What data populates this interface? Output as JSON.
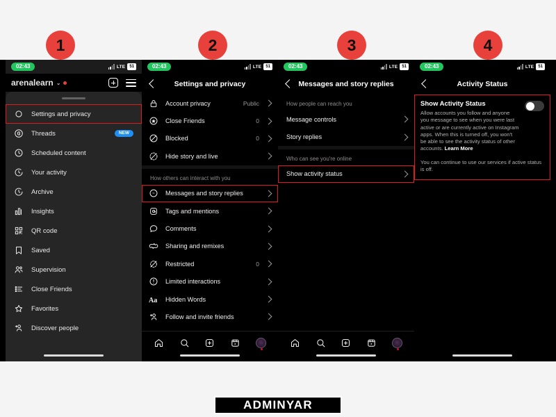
{
  "watermark": "ADMINYAR",
  "colors": {
    "accent_red": "#e8403a",
    "highlight_red": "#e01b1b",
    "badge_blue": "#1f8ff5",
    "clock_green": "#22c55e"
  },
  "statusbar": {
    "time": "02:43",
    "network": "LTE",
    "battery": "51"
  },
  "steps": [
    {
      "number": "1"
    },
    {
      "number": "2"
    },
    {
      "number": "3"
    },
    {
      "number": "4"
    }
  ],
  "panel1": {
    "username": "arenalearn",
    "caret": "⌄",
    "menu": [
      {
        "label": "Settings and privacy",
        "icon": "gear-icon",
        "badge": "",
        "highlight": true
      },
      {
        "label": "Threads",
        "icon": "threads-icon",
        "badge": "NEW",
        "highlight": false
      },
      {
        "label": "Scheduled content",
        "icon": "clock-icon",
        "badge": "",
        "highlight": false
      },
      {
        "label": "Your activity",
        "icon": "activity-clock-icon",
        "badge": "",
        "highlight": false
      },
      {
        "label": "Archive",
        "icon": "archive-clock-icon",
        "badge": "",
        "highlight": false
      },
      {
        "label": "Insights",
        "icon": "insights-chart-icon",
        "badge": "",
        "highlight": false
      },
      {
        "label": "QR code",
        "icon": "qr-code-icon",
        "badge": "",
        "highlight": false
      },
      {
        "label": "Saved",
        "icon": "bookmark-icon",
        "badge": "",
        "highlight": false
      },
      {
        "label": "Supervision",
        "icon": "supervision-people-icon",
        "badge": "",
        "highlight": false
      },
      {
        "label": "Close Friends",
        "icon": "close-friends-list-icon",
        "badge": "",
        "highlight": false
      },
      {
        "label": "Favorites",
        "icon": "star-icon",
        "badge": "",
        "highlight": false
      },
      {
        "label": "Discover people",
        "icon": "discover-people-icon",
        "badge": "",
        "highlight": false
      }
    ]
  },
  "panel2": {
    "title": "Settings and privacy",
    "group1": [
      {
        "label": "Account privacy",
        "value": "Public",
        "icon": "lock-icon",
        "highlight": false
      },
      {
        "label": "Close Friends",
        "value": "0",
        "icon": "star-circle-icon",
        "highlight": false
      },
      {
        "label": "Blocked",
        "value": "0",
        "icon": "blocked-icon",
        "highlight": false
      },
      {
        "label": "Hide story and live",
        "value": "",
        "icon": "hide-story-icon",
        "highlight": false
      }
    ],
    "section_header": "How others can interact with you",
    "group2": [
      {
        "label": "Messages and story replies",
        "value": "",
        "icon": "messenger-icon",
        "highlight": true
      },
      {
        "label": "Tags and mentions",
        "value": "",
        "icon": "at-icon",
        "highlight": false
      },
      {
        "label": "Comments",
        "value": "",
        "icon": "comment-icon",
        "highlight": false
      },
      {
        "label": "Sharing and remixes",
        "value": "",
        "icon": "remix-icon",
        "highlight": false
      },
      {
        "label": "Restricted",
        "value": "0",
        "icon": "restricted-icon",
        "highlight": false
      },
      {
        "label": "Limited interactions",
        "value": "",
        "icon": "limited-icon",
        "highlight": false
      },
      {
        "label": "Hidden Words",
        "value": "",
        "icon": "hidden-words-icon",
        "highlight": false
      },
      {
        "label": "Follow and invite friends",
        "value": "",
        "icon": "add-person-icon",
        "highlight": false
      }
    ]
  },
  "panel3": {
    "title": "Messages and story replies",
    "section1_header": "How people can reach you",
    "group1": [
      {
        "label": "Message controls",
        "highlight": false
      },
      {
        "label": "Story replies",
        "highlight": false
      }
    ],
    "section2_header": "Who can see you're online",
    "group2": [
      {
        "label": "Show activity status",
        "highlight": true
      }
    ]
  },
  "panel4": {
    "title": "Activity Status",
    "setting_title": "Show Activity Status",
    "description": "Allow accounts you follow and anyone you message to see when you were last active or are currently active on Instagram apps. When this is turned off, you won't be able to see the activity status of other accounts.",
    "learn_more": "Learn More",
    "note": "You can continue to use our services if active status is off.",
    "toggle_state": "off"
  },
  "bottom_nav": [
    {
      "name": "home-icon"
    },
    {
      "name": "search-icon"
    },
    {
      "name": "create-icon"
    },
    {
      "name": "reels-icon"
    },
    {
      "name": "profile-avatar"
    }
  ]
}
